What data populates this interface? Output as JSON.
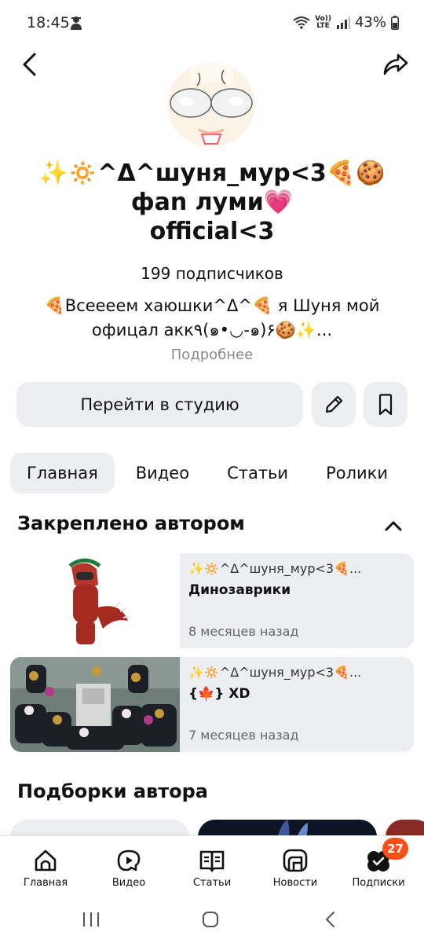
{
  "status_bar": {
    "time": "18:45",
    "volte_line1": "Vo))",
    "volte_line2": "LTE",
    "battery": "43%"
  },
  "profile": {
    "name": "✨🔅^Δ^шуня_мур<3🍕🍪\nфаn луми💗\nofficial<3",
    "subscribers": "199 подписчиков",
    "bio": "🍕Всеееем хаюшки^Δ^🍕 я Шуня мой\nофицал акк٩(๑•◡-๑)۶🍪✨...",
    "more_label": "Подробнее"
  },
  "actions": {
    "studio_label": "Перейти в студию"
  },
  "tabs": [
    {
      "label": "Главная",
      "active": true
    },
    {
      "label": "Видео",
      "active": false
    },
    {
      "label": "Статьи",
      "active": false
    },
    {
      "label": "Ролики",
      "active": false
    }
  ],
  "pinned": {
    "title": "Закреплено автором",
    "items": [
      {
        "author": "✨🔅^Δ^шуня_мур<3🍕...",
        "title": "Динозаврики",
        "date": "8 месяцев назад"
      },
      {
        "author": "✨🔅^Δ^шуня_мур<3🍕...",
        "title": "{🍁} XD",
        "date": "7 месяцев назад"
      }
    ]
  },
  "collections": {
    "title": "Подборки автора"
  },
  "bottom_nav": {
    "items": [
      {
        "label": "Главная",
        "icon": "home-icon"
      },
      {
        "label": "Видео",
        "icon": "video-icon"
      },
      {
        "label": "Статьи",
        "icon": "articles-icon"
      },
      {
        "label": "Новости",
        "icon": "news-icon"
      },
      {
        "label": "Подписки",
        "icon": "subscriptions-icon"
      }
    ],
    "badge": "27"
  },
  "colors": {
    "accent_badge": "#ff4f18",
    "chip_background": "#eceef1",
    "secondary_text": "#8a8a8a"
  }
}
